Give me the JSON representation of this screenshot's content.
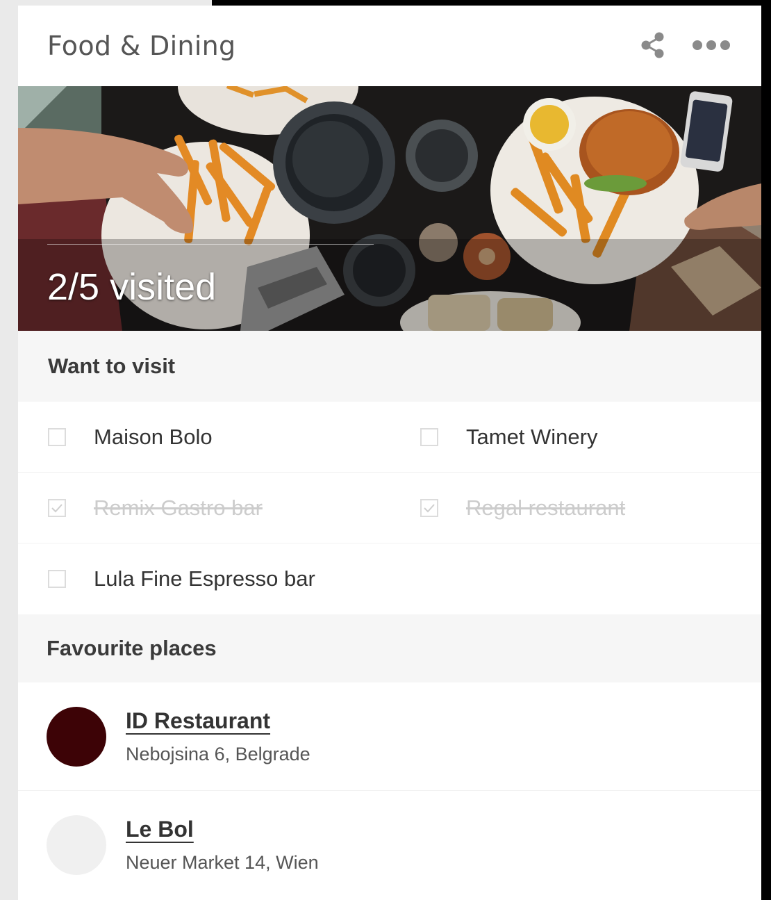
{
  "header": {
    "title": "Food & Dining",
    "share_icon": "share-icon",
    "more_icon": "more-horizontal-icon"
  },
  "hero": {
    "image": "food-table-photo",
    "progress_text": "2/5 visited"
  },
  "want_to_visit": {
    "heading": "Want to visit",
    "items": [
      {
        "label": "Maison Bolo",
        "checked": false
      },
      {
        "label": "Tamet Winery",
        "checked": false
      },
      {
        "label": "Remix Gastro bar",
        "checked": true
      },
      {
        "label": "Regal restaurant",
        "checked": true
      },
      {
        "label": "Lula Fine Espresso bar",
        "checked": false
      }
    ]
  },
  "favourites": {
    "heading": "Favourite places",
    "places": [
      {
        "name": "ID Restaurant",
        "address": "Nebojsina 6, Belgrade",
        "avatar_color": "#3d0306"
      },
      {
        "name": "Le Bol",
        "address": "Neuer Market 14, Wien",
        "avatar_color": "#f0f0f0"
      }
    ]
  },
  "colors": {
    "page_background": "#000000",
    "card_background": "#ffffff",
    "section_background": "#f6f6f6",
    "done_text": "#cccccc"
  }
}
